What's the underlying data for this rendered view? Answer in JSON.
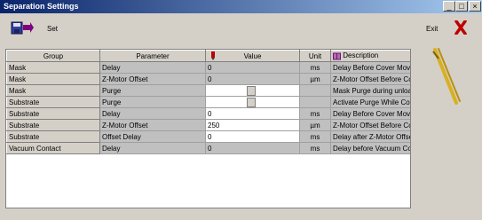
{
  "window": {
    "title": "Separation Settings"
  },
  "toolbar": {
    "set_label": "Set",
    "exit_label": "Exit"
  },
  "table": {
    "headers": [
      "Group",
      "Parameter",
      "Value",
      "Unit",
      "Description"
    ],
    "rows": [
      {
        "group": "Mask",
        "parameter": "Delay",
        "value": "0",
        "unit": "ms",
        "description": "Delay Before Cover Move Up"
      },
      {
        "group": "Mask",
        "parameter": "Z-Motor Offset",
        "value": "0",
        "unit": "µm",
        "description": "Z-Motor Offset Before Cover"
      },
      {
        "group": "Mask",
        "parameter": "Purge",
        "value": "",
        "unit": "",
        "description": "Mask Purge during unload"
      },
      {
        "group": "Substrate",
        "parameter": "Purge",
        "value": "",
        "unit": "",
        "description": "Activate Purge While Cover"
      },
      {
        "group": "Substrate",
        "parameter": "Delay",
        "value": "0",
        "unit": "ms",
        "description": "Delay Before Cover Move Up"
      },
      {
        "group": "Substrate",
        "parameter": "Z-Motor Offset",
        "value": "250",
        "unit": "µm",
        "description": "Z-Motor Offset Before Cover"
      },
      {
        "group": "Substrate",
        "parameter": "Offset Delay",
        "value": "0",
        "unit": "ms",
        "description": "Delay after Z-Motor Offset"
      },
      {
        "group": "Vacuum Contact",
        "parameter": "Delay",
        "value": "0",
        "unit": "ms",
        "description": "Delay before Vacuum Contact"
      }
    ]
  }
}
